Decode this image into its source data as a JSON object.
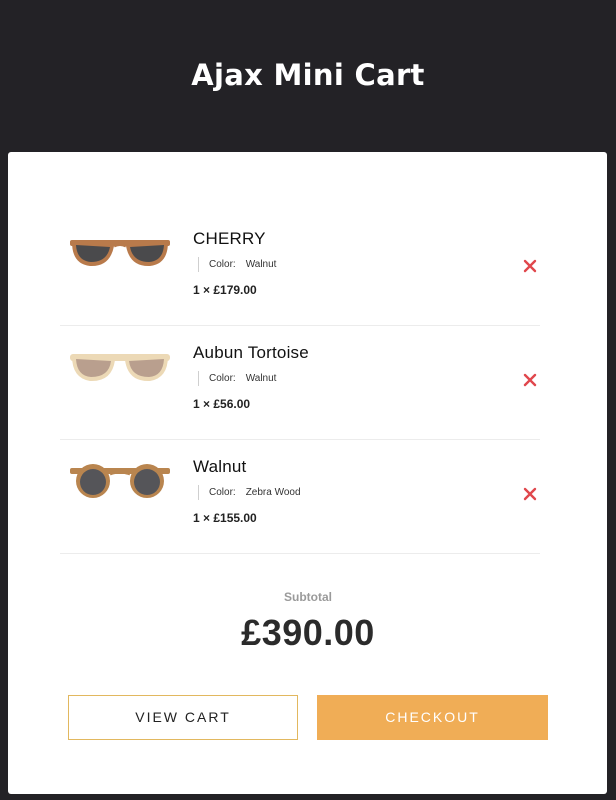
{
  "header": {
    "title": "Ajax Mini Cart"
  },
  "cart": {
    "items": [
      {
        "name": "CHERRY",
        "color_label": "Color:",
        "color_value": "Walnut",
        "price_line": "1 × £179.00",
        "image_icon": "sunglasses-image",
        "frame_color": "#b87a4b",
        "lens_color": "#4a4a4c"
      },
      {
        "name": "Aubun Tortoise",
        "color_label": "Color:",
        "color_value": "Walnut",
        "price_line": "1 × £56.00",
        "image_icon": "sunglasses-image",
        "frame_color": "#ecd9b6",
        "lens_color": "#b99f8e"
      },
      {
        "name": "Walnut",
        "color_label": "Color:",
        "color_value": "Zebra Wood",
        "price_line": "1 × £155.00",
        "image_icon": "sunglasses-image",
        "frame_color": "#b9854f",
        "lens_color": "#555559"
      }
    ],
    "remove_icon": "close-icon",
    "remove_color": "#e0474c"
  },
  "summary": {
    "subtotal_label": "Subtotal",
    "subtotal_value": "£390.00"
  },
  "actions": {
    "view_cart_label": "VIEW CART",
    "checkout_label": "CHECKOUT",
    "checkout_color": "#f0ad56"
  }
}
